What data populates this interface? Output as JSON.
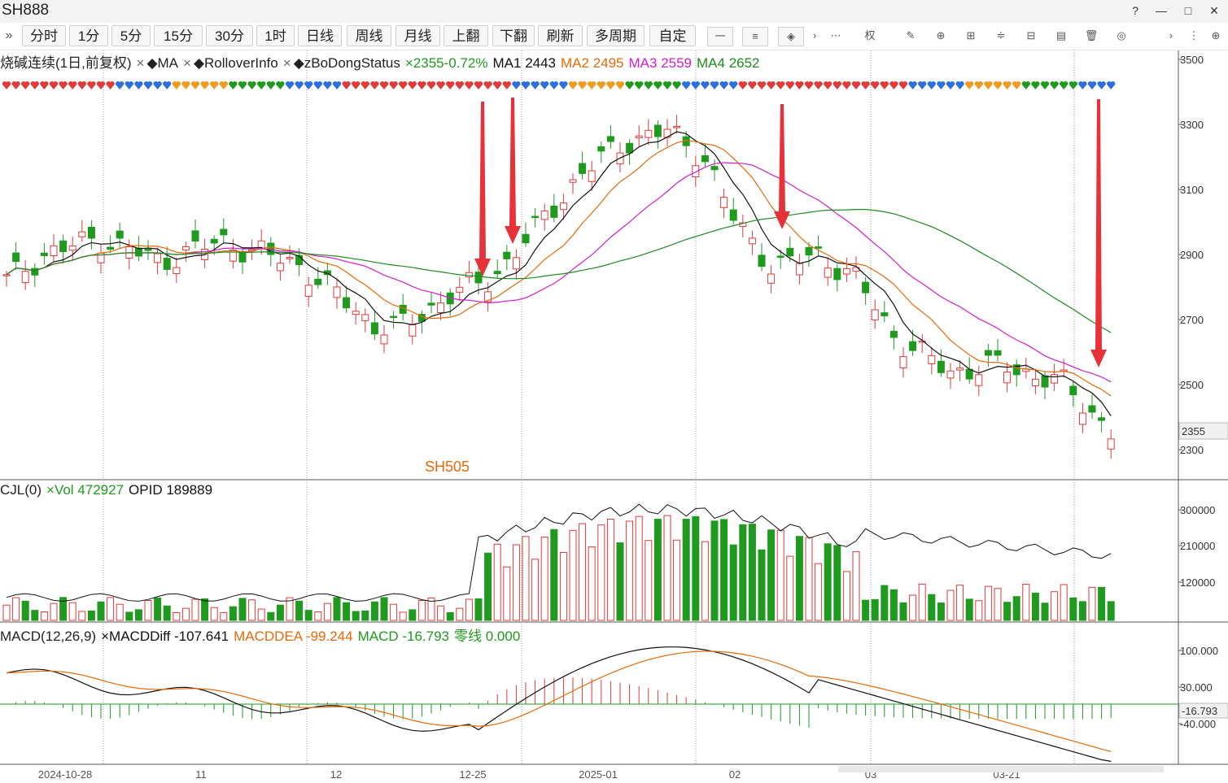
{
  "window": {
    "title": "SH888",
    "buttons": [
      "?",
      "—",
      "□",
      "✕"
    ]
  },
  "toolbar": {
    "expand": "»",
    "periods": [
      "分时",
      "1分",
      "5分",
      "15分",
      "30分",
      "1时",
      "日线",
      "周线",
      "月线",
      "上翻",
      "下翻",
      "刷新",
      "多周期",
      "自定"
    ],
    "tools": [
      "一",
      "≡",
      "◈",
      "›",
      "⋯",
      "权",
      "✎",
      "⊕",
      "⊞",
      "≑",
      "⊟",
      "▤",
      "🗑",
      "◎",
      "›",
      "⋮",
      "⊕"
    ]
  },
  "price_panel": {
    "legend": [
      {
        "text": "烧碱连续(1日,前复权)",
        "color": "#222222"
      },
      {
        "text": "×",
        "color": "#666666"
      },
      {
        "text": "◆MA",
        "color": "#222222"
      },
      {
        "text": "×",
        "color": "#666666"
      },
      {
        "text": "◆RolloverInfo",
        "color": "#222222"
      },
      {
        "text": "×",
        "color": "#666666"
      },
      {
        "text": "◆zBoDongStatus",
        "color": "#222222"
      },
      {
        "text": "×2355-0.72%",
        "color": "#1f9a1f"
      },
      {
        "text": "MA1 2443",
        "color": "#111111"
      },
      {
        "text": "MA2 2495",
        "color": "#e86a0a"
      },
      {
        "text": "MA3 2559",
        "color": "#d21fcf"
      },
      {
        "text": "MA4 2652",
        "color": "#1f8a1f"
      }
    ],
    "annotation": "SH505",
    "y_ticks": [
      "3500",
      "3300",
      "3100",
      "2900",
      "2700",
      "2500",
      "2300"
    ],
    "last_price": "2355"
  },
  "volume_panel": {
    "legend": [
      {
        "text": "CJL(0)",
        "color": "#222222"
      },
      {
        "text": "×Vol 472927",
        "color": "#1f9a1f"
      },
      {
        "text": "OPID 189889",
        "color": "#111111"
      }
    ],
    "y_ticks": [
      "300000",
      "210000",
      "120000"
    ]
  },
  "macd_panel": {
    "legend": [
      {
        "text": "MACD(12,26,9)",
        "color": "#222222"
      },
      {
        "text": "×MACDDiff -107.641",
        "color": "#111111"
      },
      {
        "text": "MACDDEA -99.244",
        "color": "#e86a0a"
      },
      {
        "text": "MACD -16.793",
        "color": "#1f9a1f"
      },
      {
        "text": "零线 0.000",
        "color": "#1f9a1f"
      }
    ],
    "y_ticks": [
      "100.000",
      "30.000",
      "-40.000"
    ],
    "last_value": "-16.793"
  },
  "x_axis": {
    "labels": [
      "2024-10-28",
      "11",
      "12",
      "12-25",
      "2025-01",
      "02",
      "03",
      "03-21"
    ]
  },
  "colors": {
    "up": "#e03a3a",
    "down": "#1f9a1f",
    "arrow": "#e8323a",
    "grid": "#888888"
  }
}
